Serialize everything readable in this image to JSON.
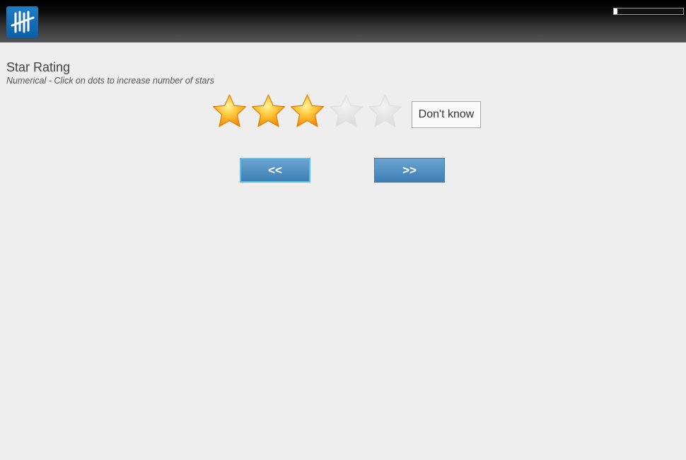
{
  "header": {
    "logo_icon": "tally-marks-icon",
    "progress": 0.05
  },
  "question": {
    "title": "Star Rating",
    "subtitle": "Numerical - Click on dots to increase number of stars"
  },
  "rating": {
    "max": 5,
    "value": 3,
    "filled_color": "#f9a825",
    "empty_color": "#e2e2e2",
    "dont_know_label": "Don't know"
  },
  "navigation": {
    "back_label": "<<",
    "next_label": ">>"
  }
}
